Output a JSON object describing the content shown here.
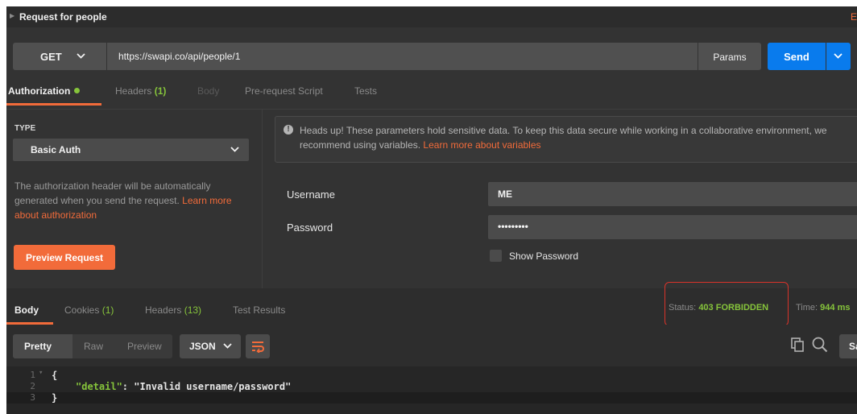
{
  "request": {
    "name": "Request for people",
    "title_right_char": "E",
    "method": "GET",
    "url": "https://swapi.co/api/people/1",
    "params_label": "Params",
    "send_label": "Send"
  },
  "request_tabs": {
    "authorization": "Authorization",
    "headers": "Headers",
    "headers_count": "(1)",
    "body": "Body",
    "pre_request_script": "Pre-request Script",
    "tests": "Tests"
  },
  "auth": {
    "type_label": "TYPE",
    "type_value": "Basic Auth",
    "description": "The authorization header will be automatically generated when you send the request.",
    "learn_more": "Learn more about authorization",
    "preview_button": "Preview Request",
    "notice_text": "Heads up! These parameters hold sensitive data. To keep this data secure while working in a collaborative environment, we recommend using variables.",
    "notice_link": "Learn more about variables",
    "username_label": "Username",
    "username_value": "ME",
    "password_label": "Password",
    "password_value": "•••••••••",
    "show_password_label": "Show Password",
    "show_password_checked": false
  },
  "response_tabs": {
    "body": "Body",
    "cookies": "Cookies",
    "cookies_count": "(1)",
    "headers": "Headers",
    "headers_count": "(13)",
    "test_results": "Test Results"
  },
  "response_meta": {
    "status_label": "Status:",
    "status_value": "403 FORBIDDEN",
    "time_label": "Time:",
    "time_value": "944 ms"
  },
  "response_toolbar": {
    "pretty": "Pretty",
    "raw": "Raw",
    "preview": "Preview",
    "format": "JSON",
    "save_label": "Sa"
  },
  "code": {
    "line_numbers": [
      "1",
      "2",
      "3"
    ],
    "line1": "{",
    "key": "\"detail\"",
    "sep": ": ",
    "value": "\"Invalid username/password\"",
    "line3": "}"
  },
  "colors": {
    "accent_orange": "#f26b3a",
    "send_blue": "#097bed",
    "status_green": "#86c43b",
    "highlight_red": "#d8332a"
  },
  "icons": [
    "caret-right-icon",
    "chevron-down-icon",
    "info-icon",
    "wrap-lines-icon",
    "copy-icon",
    "search-icon",
    "fold-arrow-icon"
  ]
}
